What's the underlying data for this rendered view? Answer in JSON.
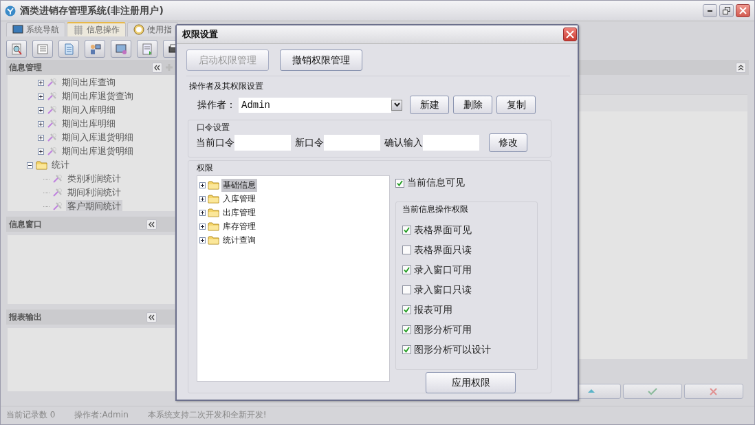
{
  "window": {
    "title": "酒类进销存管理系统(非注册用户)"
  },
  "tabs": [
    {
      "label": "系统导航",
      "selected": false
    },
    {
      "label": "信息操作",
      "selected": true
    },
    {
      "label": "使用指",
      "selected": false
    }
  ],
  "left_panels": [
    {
      "title": "信息管理",
      "tree": [
        {
          "label": "期间出库查询",
          "kind": "report",
          "expanded": false,
          "selected": false
        },
        {
          "label": "期间出库退货查询",
          "kind": "report",
          "expanded": false,
          "selected": false
        },
        {
          "label": "期间入库明细",
          "kind": "report",
          "expanded": false,
          "selected": false
        },
        {
          "label": "期间出库明细",
          "kind": "report",
          "expanded": false,
          "selected": false
        },
        {
          "label": "期间入库退货明细",
          "kind": "report",
          "expanded": false,
          "selected": false
        },
        {
          "label": "期间出库退货明细",
          "kind": "report",
          "expanded": false,
          "selected": false
        },
        {
          "label": "统计",
          "kind": "folder",
          "expanded": true,
          "selected": false,
          "children": [
            {
              "label": "类别利润统计",
              "kind": "leaf",
              "selected": false
            },
            {
              "label": "期间利润统计",
              "kind": "leaf",
              "selected": false
            },
            {
              "label": "客户期间统计",
              "kind": "leaf",
              "selected": true
            }
          ]
        }
      ]
    },
    {
      "title": "信息窗口"
    },
    {
      "title": "报表输出"
    }
  ],
  "status_bar": [
    "当前记录数 0",
    "操作者:Admin",
    "本系统支持二次开发和全新开发!"
  ],
  "dialog": {
    "title": "权限设置",
    "mode_buttons": [
      {
        "label": "启动权限管理",
        "disabled": true
      },
      {
        "label": "撤销权限管理",
        "disabled": false
      }
    ],
    "operator_section": {
      "title": "操作者及其权限设置",
      "label": "操作者：",
      "value": "Admin",
      "buttons": [
        "新建",
        "删除",
        "复制"
      ]
    },
    "password_section": {
      "title": "口令设置",
      "fields": [
        {
          "label": "当前口令"
        },
        {
          "label": "新口令"
        },
        {
          "label": "确认输入"
        }
      ],
      "button": "修改"
    },
    "permission_section": {
      "title": "权限",
      "tree": [
        {
          "label": "基础信息",
          "expanded": false,
          "selected": true
        },
        {
          "label": "入库管理",
          "expanded": false,
          "selected": false
        },
        {
          "label": "出库管理",
          "expanded": false,
          "selected": false
        },
        {
          "label": "库存管理",
          "expanded": false,
          "selected": false
        },
        {
          "label": "统计查询",
          "expanded": false,
          "selected": false
        }
      ],
      "visible_check": {
        "label": "当前信息可见",
        "checked": true
      },
      "ops_group": {
        "title": "当前信息操作权限",
        "items": [
          {
            "label": "表格界面可见",
            "checked": true
          },
          {
            "label": "表格界面只读",
            "checked": false
          },
          {
            "label": "录入窗口可用",
            "checked": true
          },
          {
            "label": "录入窗口只读",
            "checked": false
          },
          {
            "label": "报表可用",
            "checked": true
          },
          {
            "label": "图形分析可用",
            "checked": true
          },
          {
            "label": "图形分析可以设计",
            "checked": true
          }
        ]
      },
      "apply_button": "应用权限"
    }
  }
}
